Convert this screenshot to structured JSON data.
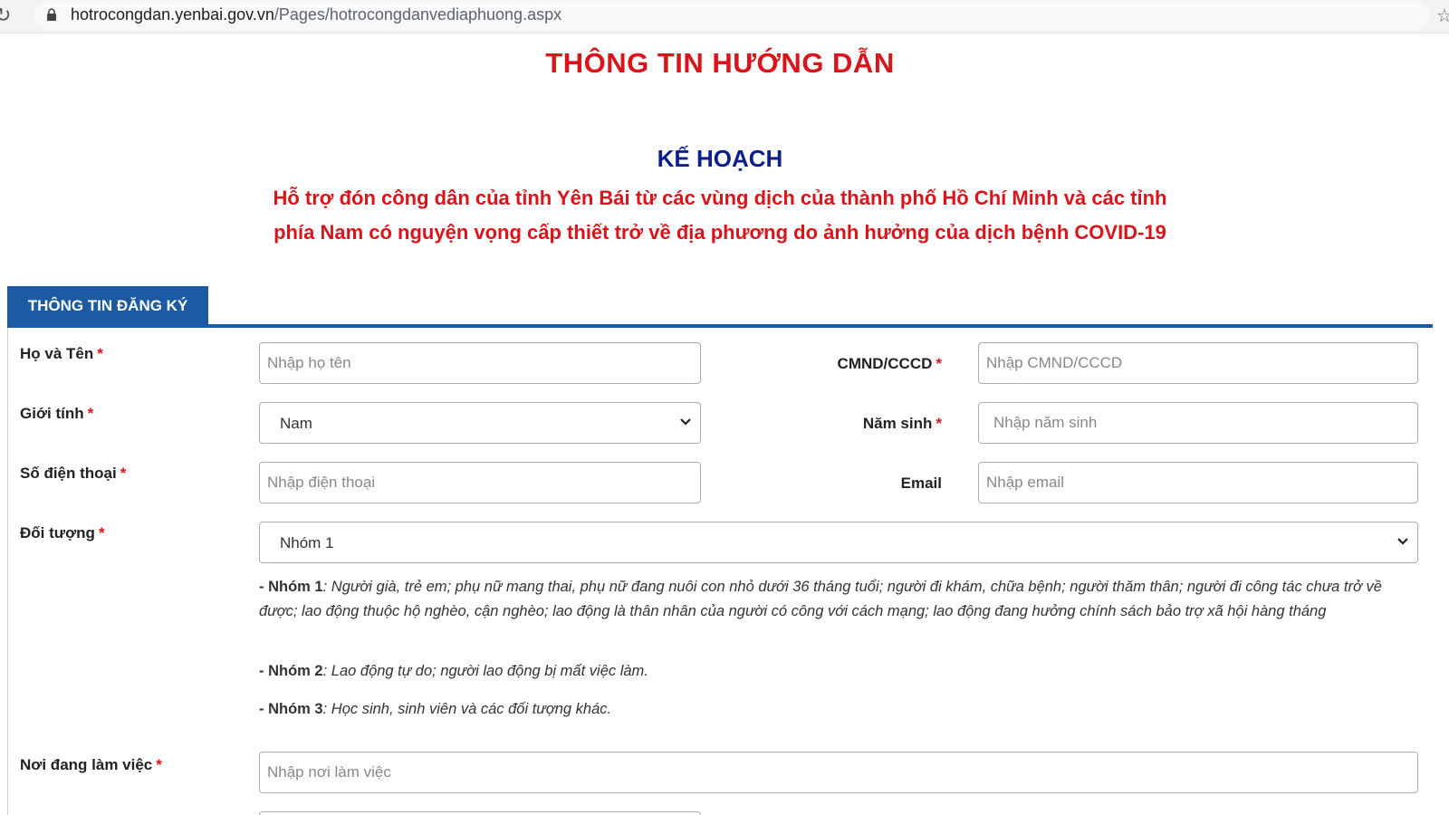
{
  "browser": {
    "url_domain": "hotrocongdan.yenbai.gov.vn",
    "url_path": "/Pages/hotrocongdanvediaphuong.aspx"
  },
  "page": {
    "title": "THÔNG TIN HƯỚNG DẪN",
    "plan_title": "KẾ HOẠCH",
    "plan_subtitle": "Hỗ trợ đón công dân của tỉnh Yên Bái từ các vùng dịch của thành phố Hồ Chí Minh và các tỉnh phía Nam có nguyện vọng cấp thiết trở về địa phương do ảnh hưởng của dịch bệnh COVID-19"
  },
  "form": {
    "section_title": "THÔNG TIN ĐĂNG KÝ",
    "required_mark": "*",
    "full_name": {
      "label": "Họ và Tên",
      "placeholder": "Nhập họ tên"
    },
    "id_card": {
      "label": "CMND/CCCD",
      "placeholder": "Nhập CMND/CCCD"
    },
    "gender": {
      "label": "Giới tính",
      "value": "Nam"
    },
    "birth_year": {
      "label": "Năm sinh",
      "placeholder": "Nhập năm sinh"
    },
    "phone": {
      "label": "Số điện thoại",
      "placeholder": "Nhập điện thoại"
    },
    "email": {
      "label": "Email",
      "placeholder": "Nhập email"
    },
    "group": {
      "label": "Đối tượng",
      "value": "Nhóm 1",
      "descriptions": [
        {
          "name": "Nhóm 1",
          "text": "Người già, trẻ em; phụ nữ mang thai, phụ nữ đang nuôi con nhỏ dưới 36 tháng tuổi; người đi khám, chữa bệnh; người thăm thân; người đi công tác chưa trở về được; lao động thuộc hộ nghèo, cận nghèo; lao động là thân nhân của người có công với cách mạng; lao động đang hưởng chính sách bảo trợ xã hội hàng tháng"
        },
        {
          "name": "Nhóm 2",
          "text": "Lao động tự do; người lao động bị mất việc làm."
        },
        {
          "name": "Nhóm 3",
          "text": "Học sinh, sinh viên và các đối tượng khác."
        }
      ]
    },
    "workplace": {
      "label": "Nơi đang làm việc",
      "placeholder": "Nhập nơi làm việc"
    }
  },
  "colors": {
    "accent_red": "#d9141a",
    "navy": "#0d1f8f",
    "tab_blue": "#1c5aa3"
  }
}
